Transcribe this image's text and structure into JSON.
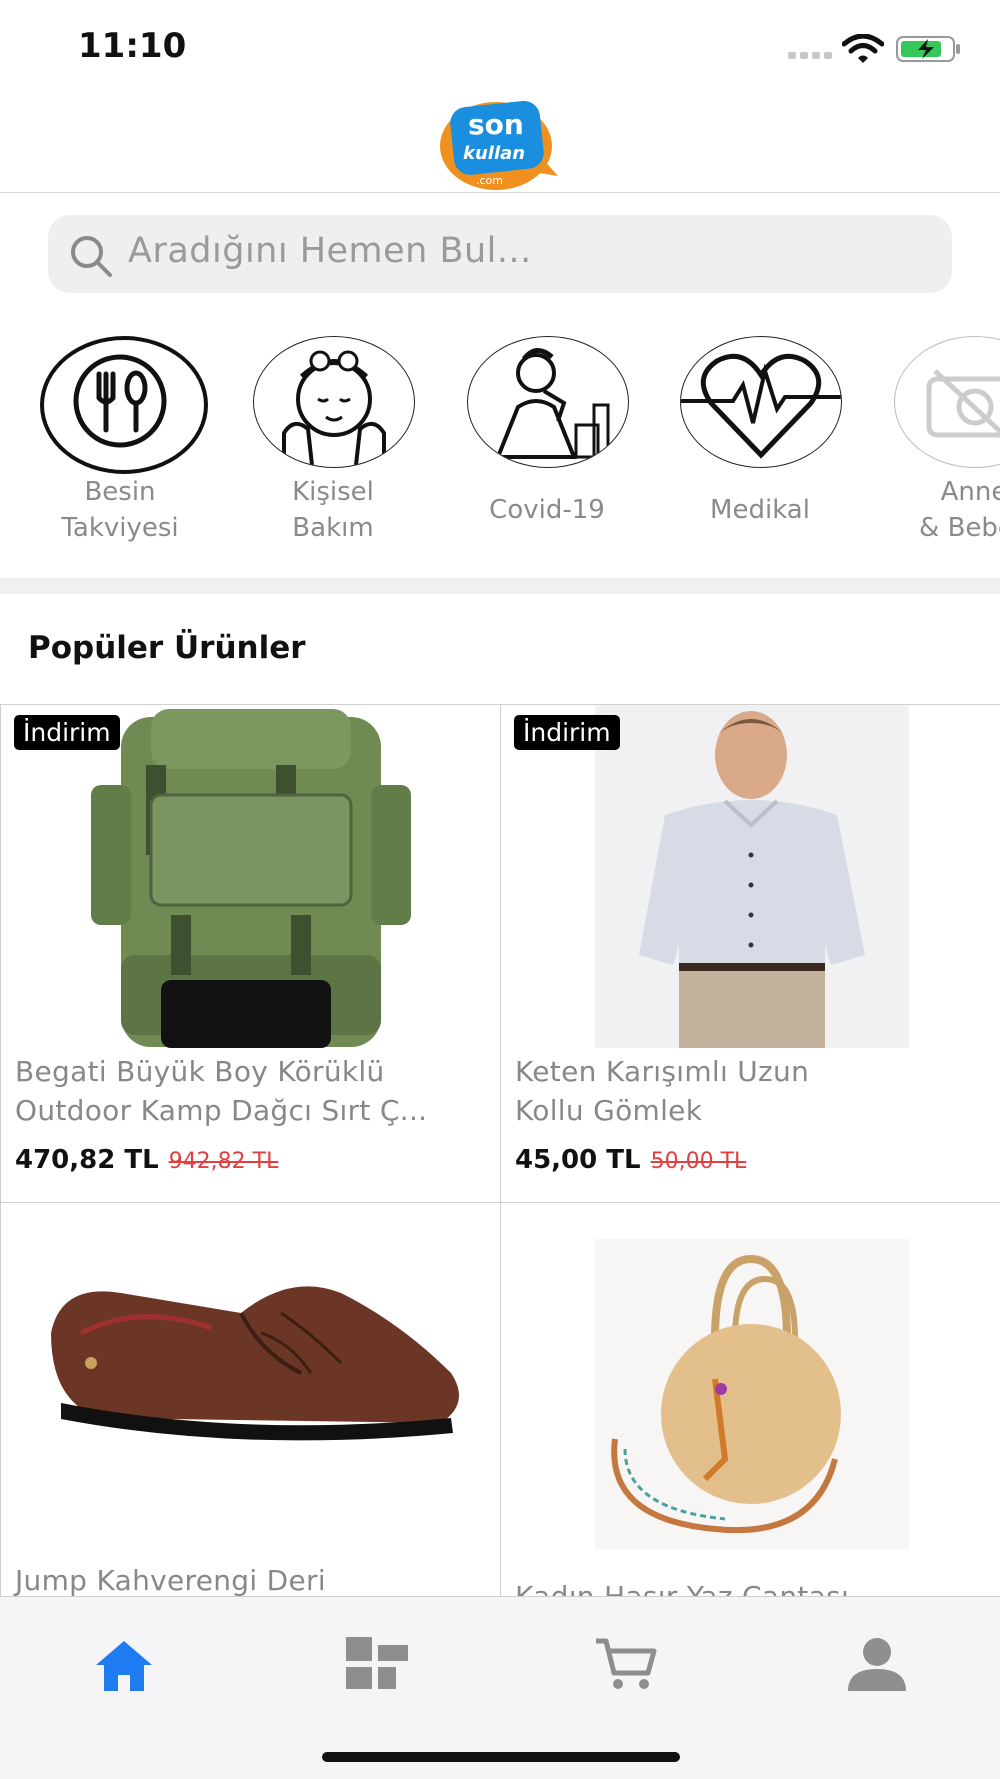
{
  "status_bar": {
    "time": "11:10"
  },
  "header": {
    "logo_top": "son",
    "logo_bottom": "kullan",
    "logo_domain": ".com"
  },
  "search": {
    "placeholder": "Aradığını Hemen Bul..."
  },
  "categories": [
    {
      "label_line1": "Besin",
      "label_line2": "Takviyesi",
      "icon": "fork-spoon-icon"
    },
    {
      "label_line1": "Kişisel",
      "label_line2": "Bakım",
      "icon": "face-care-icon"
    },
    {
      "label_line1": "Covid-19",
      "label_line2": "",
      "icon": "sneeze-icon"
    },
    {
      "label_line1": "Medikal",
      "label_line2": "",
      "icon": "heartbeat-icon"
    },
    {
      "label_line1": "Anne",
      "label_line2": "& Bebek",
      "icon": "no-photo-icon"
    }
  ],
  "section_title": "Popüler Ürünler",
  "products": [
    {
      "badge": "İndirim",
      "name_line1": "Begati Büyük Boy Körüklü",
      "name_line2": "Outdoor Kamp Dağcı Sırt Ç...",
      "price": "470,82 TL",
      "old_price": "942,82 TL"
    },
    {
      "badge": "İndirim",
      "name_line1": "Keten Karışımlı Uzun",
      "name_line2": "Kollu Gömlek",
      "price": "45,00 TL",
      "old_price": "50,00 TL"
    },
    {
      "badge": "",
      "name_line1": "Jump Kahverengi Deri",
      "name_line2": "",
      "price": "",
      "old_price": ""
    },
    {
      "badge": "",
      "name_line1": "Kadın Hasır Yaz Çantası",
      "name_line2": "",
      "price": "",
      "old_price": ""
    }
  ],
  "tabbar": {
    "icons": [
      "home-icon",
      "categories-icon",
      "cart-icon",
      "profile-icon"
    ],
    "active_color": "#1e7cf0",
    "inactive_color": "#8e8e8e"
  }
}
